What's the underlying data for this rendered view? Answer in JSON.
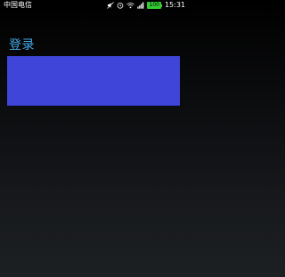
{
  "status_bar": {
    "carrier": "中国电信",
    "battery_label": "100",
    "time": "15:31",
    "icons": [
      "mute-icon",
      "alarm-icon",
      "wifi-icon",
      "signal-icon",
      "battery-icon"
    ],
    "battery_color": "#33cc33"
  },
  "page": {
    "title": "登录",
    "title_color": "#45a8e8",
    "panel_color": "#3f45d8"
  }
}
